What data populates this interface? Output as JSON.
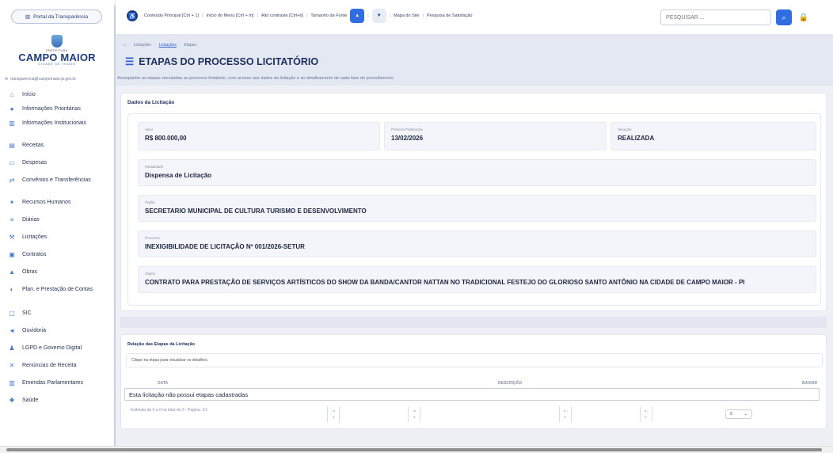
{
  "sidebar": {
    "portal_label": "Portal da Transparência",
    "logo_small": "PREFEITURA",
    "logo_name": "CAMPO MAIOR",
    "logo_tagline": "CIDADE DE TODOS",
    "email": "transparencia@campomaior.pi.gov.br",
    "items": [
      {
        "label": "Início",
        "icon": "home-icon",
        "glyph": "⌂"
      },
      {
        "label": "Informações Prioritárias",
        "icon": "info-icon",
        "glyph": "●"
      },
      {
        "label": "Informações Institucionais",
        "icon": "building-icon",
        "glyph": "▥"
      },
      {
        "label": "Receitas",
        "icon": "chart-icon",
        "glyph": "▤"
      },
      {
        "label": "Despesas",
        "icon": "money-icon",
        "glyph": "▭"
      },
      {
        "label": "Convênios e Transferências",
        "icon": "handshake-icon",
        "glyph": "⇄"
      },
      {
        "label": "Recursos Humanos",
        "icon": "people-icon",
        "glyph": "✦"
      },
      {
        "label": "Diárias",
        "icon": "calendar-icon",
        "glyph": "≡"
      },
      {
        "label": "Licitações",
        "icon": "gavel-icon",
        "glyph": "⚒"
      },
      {
        "label": "Contratos",
        "icon": "contract-icon",
        "glyph": "▣"
      },
      {
        "label": "Obras",
        "icon": "construction-icon",
        "glyph": "▲"
      },
      {
        "label": "Plan. e Prestação de Contas",
        "icon": "plan-icon",
        "glyph": "◐"
      },
      {
        "label": "SIC",
        "icon": "sic-icon",
        "glyph": "▢"
      },
      {
        "label": "Ouvidoria",
        "icon": "megaphone-icon",
        "glyph": "◄"
      },
      {
        "label": "LGPD e Governo Digital",
        "icon": "user-shield-icon",
        "glyph": "♟"
      },
      {
        "label": "Renúncias de Receita",
        "icon": "cancel-icon",
        "glyph": "✕"
      },
      {
        "label": "Emendas Parlamentares",
        "icon": "institution-icon",
        "glyph": "▥"
      },
      {
        "label": "Saúde",
        "icon": "health-icon",
        "glyph": "✚"
      }
    ]
  },
  "topbar": {
    "main_content": "Conteúdo Principal [Ctrl + 1]",
    "menu_start": "Início do Menu [Ctrl + m]",
    "contrast": "Alto contraste [Ctrl+b]",
    "font_size": "Tamanho da Fonte",
    "font_up": "▲",
    "font_down": "▼",
    "sitemap": "Mapa do Site",
    "survey": "Pesquisa de Satisfação",
    "search_placeholder": "PESQUISAR ...",
    "search_icon": "search-icon",
    "lock_icon": "lock-icon",
    "accessibility_icon": "accessibility-icon"
  },
  "breadcrumb": [
    "Licitações",
    "Licitações",
    "Etapas"
  ],
  "page": {
    "title": "ETAPAS DO PROCESSO LICITATÓRIO",
    "description": "Acompanhe as etapas vinculadas ao processo licitatório, com acesso aos dados da licitação e ao detalhamento de cada fase do procedimento."
  },
  "licitacao": {
    "section_title": "Dados da Licitação",
    "valor_label": "Valor",
    "valor": "R$ 800.000,00",
    "publicacao_label": "Primeira Publicação",
    "publicacao": "13/02/2026",
    "situacao_label": "Situação",
    "situacao": "REALIZADA",
    "modalidade_label": "Modalidade",
    "modalidade": "Dispensa de Licitação",
    "orgao_label": "Órgão",
    "orgao": "SECRETARIO MUNICIPAL DE CULTURA TURISMO E DESENVOLVIMENTO",
    "processo_label": "Processo",
    "processo": "INEXIGIBILIDADE DE LICITAÇÃO Nº 001/2026-SETUR",
    "objeto_label": "Objeto",
    "objeto": "CONTRATO PARA PRESTAÇÃO DE SERVIÇOS ARTÍSTICOS DO SHOW DA BANDA/CANTOR NATTAN NO TRADICIONAL FESTEJO DO GLORIOSO SANTO ANTÔNIO NA CIDADE DE CAMPO MAIOR - PI"
  },
  "etapas": {
    "section_title": "Relação das Etapas da Licitação",
    "hint": "Clique na etapa para visualizar os detalhes.",
    "col_data": "DATA",
    "col_descricao": "DESCRIÇÃO",
    "col_baixar": "BAIXAR",
    "empty": "Esta licitação não possui etapas cadastradas",
    "pager_info": "Exibindo de 0 a 0 no total de 0 - Página: 1/1",
    "page_size": "5"
  }
}
